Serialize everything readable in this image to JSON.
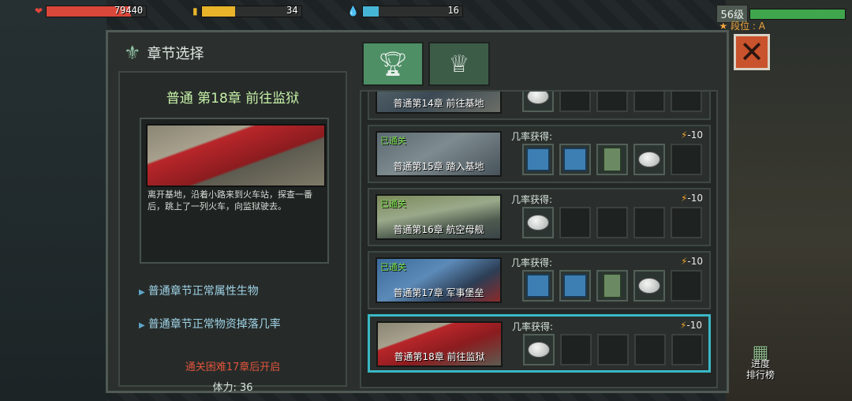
{
  "hud": {
    "hp_value": "79440",
    "energy_value": "34",
    "water_value": "16",
    "level": "56级",
    "rank": "★ 段位 : A",
    "colors": {
      "hp": "#d9473a",
      "energy": "#e8b52a",
      "water": "#46b6d6",
      "level": "#3fa64d"
    }
  },
  "panel": {
    "title": "章节选择",
    "tabs": [
      {
        "icon": "trophy-icon"
      },
      {
        "icon": "winged-trophy-icon"
      }
    ],
    "close_label": "✕"
  },
  "info": {
    "title": "普通 第18章 前往监狱",
    "description": "离开基地，沿着小路来到火车站，探查一番后，跳上了一列火车，向监狱驶去。",
    "bullet_1": "普通章节正常属性生物",
    "bullet_2": "普通章节正常物资掉落几率",
    "unlock_note": "通关困难17章后开启",
    "stamina": "体力: 36"
  },
  "chapters": [
    {
      "name": "普通第14章 前往基地",
      "cleared": "",
      "drop_label": "",
      "cost": ""
    },
    {
      "name": "普通第15章 踏入基地",
      "cleared": "已通关",
      "drop_label": "几率获得:",
      "cost": "-10"
    },
    {
      "name": "普通第16章 航空母舰",
      "cleared": "已通关",
      "drop_label": "几率获得:",
      "cost": "-10"
    },
    {
      "name": "普通第17章 军事堡垒",
      "cleared": "已通关",
      "drop_label": "几率获得:",
      "cost": "-10"
    },
    {
      "name": "普通第18章 前往监狱",
      "cleared": "",
      "drop_label": "几率获得:",
      "cost": "-10"
    }
  ],
  "leaderboard": {
    "line1": "进度",
    "line2": "排行榜"
  }
}
